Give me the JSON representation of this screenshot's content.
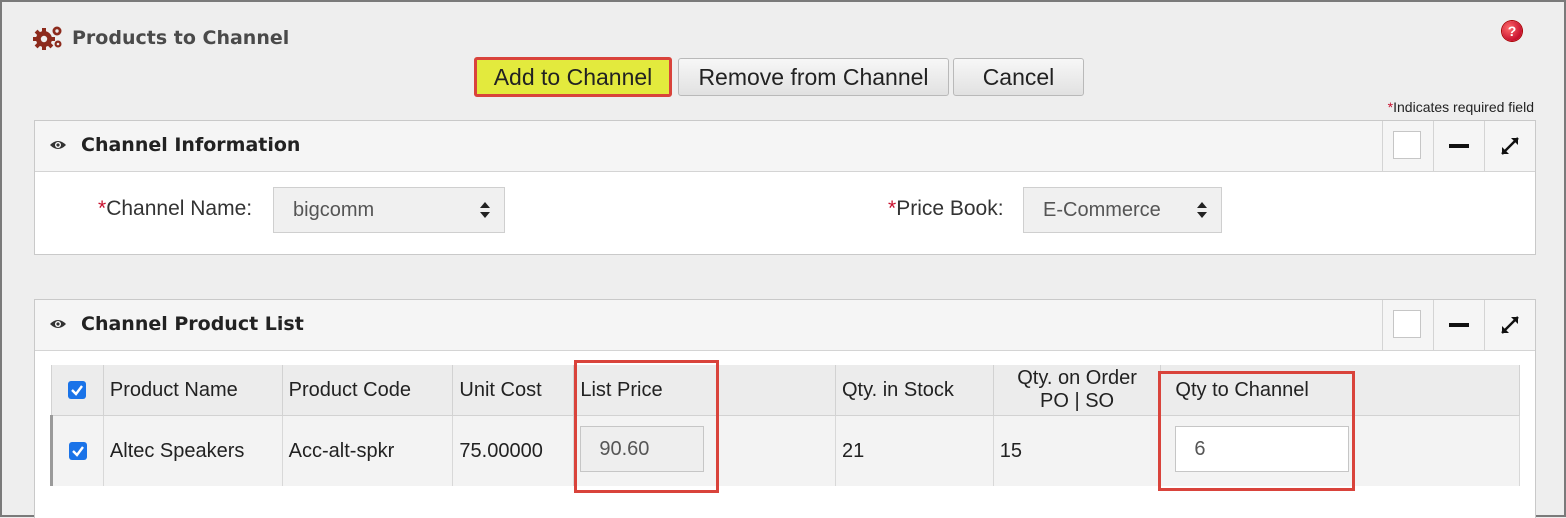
{
  "header": {
    "title": "Products to Channel",
    "help_icon": "help-icon",
    "help_glyph": "?"
  },
  "toolbar": {
    "add_label": "Add to Channel",
    "remove_label": "Remove from Channel",
    "cancel_label": "Cancel"
  },
  "required_note": {
    "star": "*",
    "text": "Indicates required field"
  },
  "channel_info": {
    "title": "Channel Information",
    "channel_name_label": "Channel Name:",
    "channel_name_value": "bigcomm",
    "price_book_label": "Price Book:",
    "price_book_value": "E-Commerce",
    "required_star": "*"
  },
  "product_list": {
    "title": "Channel Product List",
    "columns": [
      "Product Name",
      "Product Code",
      "Unit Cost",
      "List Price",
      "Qty. in Stock",
      "Qty. on Order",
      "PO | SO",
      "Qty to Channel"
    ],
    "rows": [
      {
        "checked": true,
        "product_name": "Altec Speakers",
        "product_code": "Acc-alt-spkr",
        "unit_cost": "75.00000",
        "list_price": "90.60",
        "qty_in_stock": "21",
        "qty_on_order": "15",
        "qty_to_channel": "6"
      }
    ]
  },
  "colors": {
    "highlight_red": "#d9433b",
    "add_button_yellow": "#e3ea3d",
    "checkbox_blue": "#1a73e8",
    "required_red": "#c8102e"
  }
}
